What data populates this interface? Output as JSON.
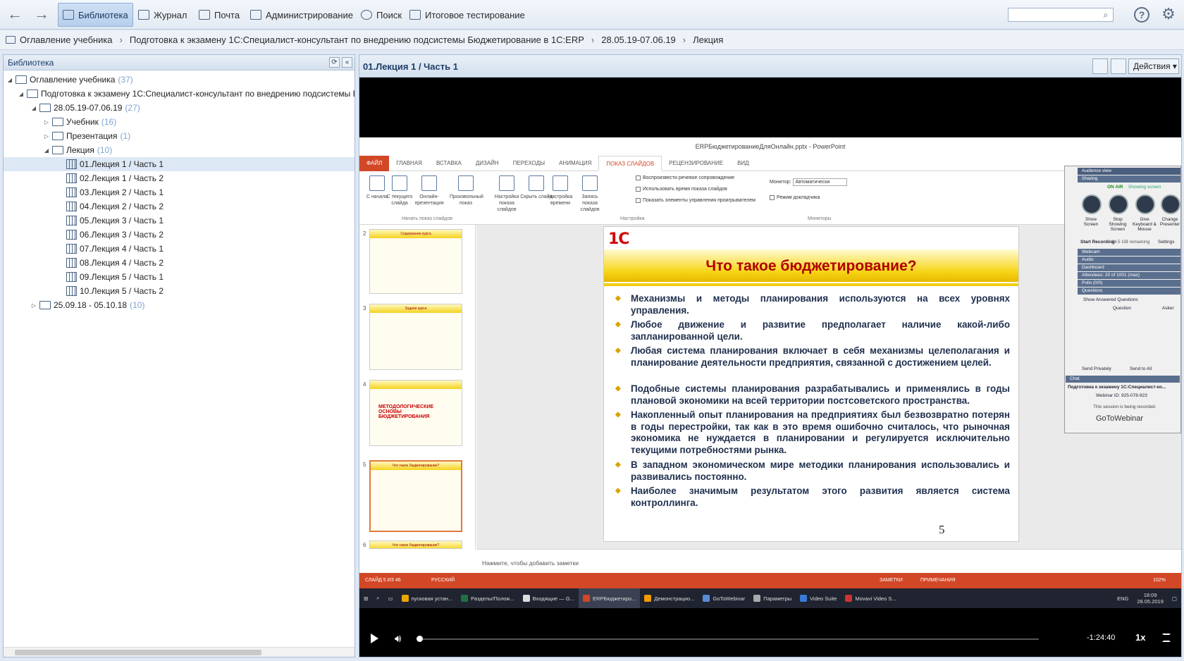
{
  "topbar": {
    "items": [
      {
        "label": "Библиотека",
        "icon": "library-icon",
        "active": true
      },
      {
        "label": "Журнал",
        "icon": "journal-icon"
      },
      {
        "label": "Почта",
        "icon": "mail-icon"
      },
      {
        "label": "Администрирование",
        "icon": "admin-icon"
      },
      {
        "label": "Поиск",
        "icon": "search-icon"
      },
      {
        "label": "Итоговое тестирование",
        "icon": "edit-icon"
      }
    ],
    "search_placeholder": ""
  },
  "breadcrumb": [
    "Оглавление учебника",
    "Подготовка к экзамену 1С:Специалист-консультант по внедрению подсистемы Бюджетирование в 1С:ERP",
    "28.05.19-07.06.19",
    "Лекция"
  ],
  "library": {
    "title": "Библиотека",
    "tree": [
      {
        "label": "Оглавление учебника",
        "count": "(37)"
      },
      {
        "label": "Подготовка к экзамену 1С:Специалист-консультант по внедрению подсистемы Бюджетирование в 1С:ERP",
        "count": ""
      },
      {
        "label": "28.05.19-07.06.19",
        "count": "(27)"
      },
      {
        "label": "Учебник",
        "count": "(16)"
      },
      {
        "label": "Презентация",
        "count": "(1)"
      },
      {
        "label": "Лекция",
        "count": "(10)"
      },
      {
        "label": "01.Лекция 1 / Часть 1",
        "count": ""
      },
      {
        "label": "02.Лекция 1 / Часть 2",
        "count": ""
      },
      {
        "label": "03.Лекция 2 / Часть 1",
        "count": ""
      },
      {
        "label": "04.Лекция 2 / Часть 2",
        "count": ""
      },
      {
        "label": "05.Лекция 3 / Часть 1",
        "count": ""
      },
      {
        "label": "06.Лекция 3 / Часть 2",
        "count": ""
      },
      {
        "label": "07.Лекция 4 / Часть 1",
        "count": ""
      },
      {
        "label": "08.Лекция 4 / Часть 2",
        "count": ""
      },
      {
        "label": "09.Лекция 5 / Часть 1",
        "count": ""
      },
      {
        "label": "10.Лекция 5 / Часть 2",
        "count": ""
      },
      {
        "label": "25.09.18 - 05.10.18",
        "count": "(10)"
      }
    ]
  },
  "viewer": {
    "title": "01.Лекция 1 / Часть 1",
    "actions_label": "Действия"
  },
  "ppt": {
    "window_title": "ERPБюджетированиеДляОнлайн.pptx - PowerPoint",
    "tabs": [
      "ФАЙЛ",
      "ГЛАВНАЯ",
      "ВСТАВКА",
      "ДИЗАЙН",
      "ПЕРЕХОДЫ",
      "АНИМАЦИЯ",
      "ПОКАЗ СЛАЙДОВ",
      "РЕЦЕНЗИРОВАНИЕ",
      "ВИД"
    ],
    "ribbon_buttons": [
      "С начала",
      "С текущего слайда",
      "Онлайн-презентация",
      "Произвольный показ",
      "Настройка показа слайдов",
      "Скрыть слайд",
      "Настройка времени",
      "Запись показа слайдов"
    ],
    "ribbon_groups": [
      "Начать показ слайдов",
      "Настройка",
      "Мониторы"
    ],
    "checks": [
      "Воспроизвести речевое сопровождение",
      "Использовать время показа слайдов",
      "Показать элементы управления проигрывателем",
      "Режим докладчика"
    ],
    "monitor_label": "Монитор:",
    "monitor_value": "Автоматически",
    "thumbs": [
      {
        "num": "2",
        "title": "Содержание курса"
      },
      {
        "num": "3",
        "title": "Задачи курса"
      },
      {
        "num": "4",
        "title": "МЕТОДОЛОГИЧЕСКИЕ ОСНОВЫ БЮДЖЕТИРОВАНИЯ"
      },
      {
        "num": "5",
        "title": "Что такое бюджетирование?"
      },
      {
        "num": "6",
        "title": "Что такое бюджетирование?"
      }
    ],
    "slide": {
      "logo": "1С",
      "title": "Что такое бюджетирование?",
      "bullets": [
        "Механизмы и методы планирования используются на всех уровнях управления.",
        "Любое движение и развитие предполагает наличие какой-либо запланированной цели.",
        "Любая система планирования включает в себя механизмы целеполагания и планирование деятельности предприятия, связанной с достижением целей.",
        "Подобные системы планирования разрабатывались и применялись в годы плановой экономики на всей территории постсоветского пространства.",
        "Накопленный опыт планирования на предприятиях был безвозвратно потерян в годы перестройки, так как в это время ошибочно считалось, что рыночная экономика не нуждается в планировании и регулируется исключительно текущими потребностями рынка.",
        "В западном экономическом мире методики планирования использовались и развивались постоянно.",
        "Наиболее значимым результатом этого развития является система контроллинга."
      ],
      "number": "5"
    },
    "notes": "Нажмите, чтобы добавить заметки",
    "status_left": "СЛАЙД 5 ИЗ 46",
    "status_lang": "РУССКИЙ",
    "status_notes": "ЗАМЕТКИ",
    "status_comments": "ПРИМЕЧАНИЯ",
    "zoom": "102%"
  },
  "gotowebinar": {
    "rows": [
      "Audience view",
      "Sharing",
      "Webcam",
      "Audio",
      "Dashboard",
      "Attendees: 20 of 1001 (max)",
      "Polls (0/0)",
      "Questions",
      "Chat"
    ],
    "on_air": "ON AIR",
    "showing": "Showing screen",
    "buttons": [
      "Show Screen",
      "Stop Showing Screen",
      "Give Keyboard & Mouse",
      "Change Presenter"
    ],
    "start_recording": "Start Recording",
    "remaining": "24.5 GB remaining",
    "settings": "Settings",
    "show_answered": "Show Answered Questions",
    "col_question": "Question",
    "col_asker": "Asker",
    "send_privately": "Send Privately",
    "send_all": "Send to All",
    "webinar_name": "Подготовка к экзамену 1С:Специалист-ко...",
    "webinar_id": "Webinar ID: 925-078-923",
    "recording_note": "This session is being recorded.",
    "brand": "GoToWebinar"
  },
  "taskbar": {
    "items": [
      "пусковая устан...",
      "Разделы!Полож...",
      "Входящие — G...",
      "ERPБюджетиро...",
      "Демонстрацио...",
      "GoToWebinar",
      "Параметры",
      "Video Suite",
      "Movavi Video S..."
    ],
    "lang": "ENG",
    "time": "18:09",
    "date": "28.05.2019"
  },
  "player": {
    "time_left": "-1:24:40",
    "speed": "1x",
    "progress": 0.003
  }
}
